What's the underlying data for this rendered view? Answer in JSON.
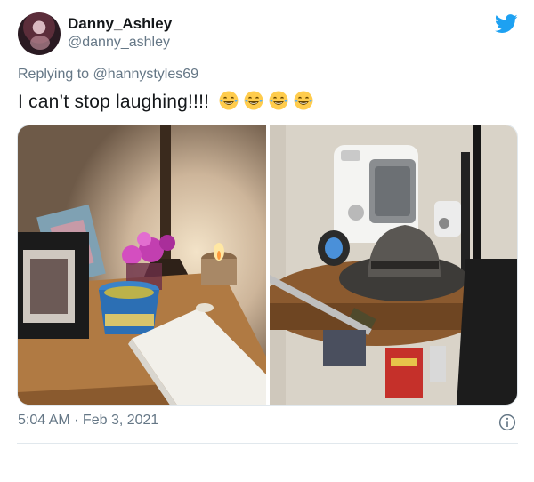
{
  "tweet": {
    "display_name": "Danny_Ashley",
    "handle": "@danny_ashley",
    "replying_prefix": "Replying to ",
    "replying_to": "@hannystyles69",
    "text": "I can’t stop laughing!!!!",
    "emoji_count": 4,
    "emoji_name": "face-with-tears-of-joy",
    "timestamp": "5:04 AM · Feb 3, 2021"
  },
  "icons": {
    "brand": "twitter-bird-icon",
    "info": "info-icon"
  },
  "colors": {
    "brand_blue": "#1da1f2",
    "secondary_text": "#657786",
    "primary_text": "#14171a",
    "border": "#e1e8ed"
  }
}
